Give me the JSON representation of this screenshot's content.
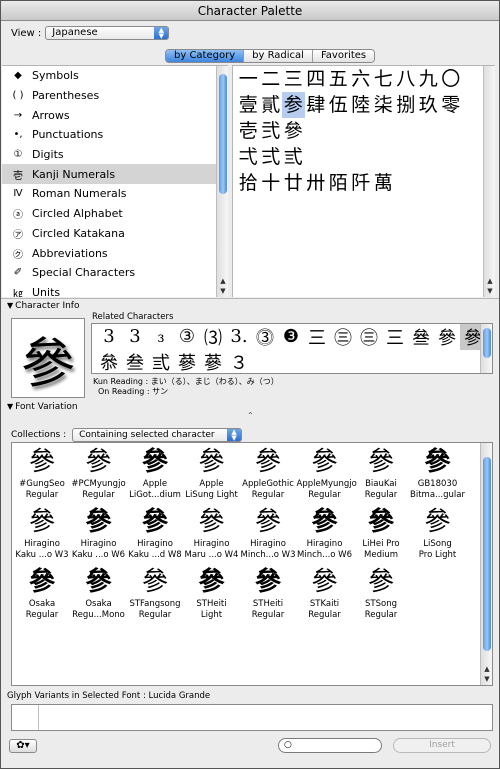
{
  "window": {
    "title": "Character Palette"
  },
  "view": {
    "label": "View :",
    "value": "Japanese"
  },
  "tabs": [
    {
      "label": "by Category",
      "active": true
    },
    {
      "label": "by Radical",
      "active": false
    },
    {
      "label": "Favorites",
      "active": false
    }
  ],
  "categories": [
    {
      "icon": "◆",
      "label": "Symbols"
    },
    {
      "icon": "( )",
      "label": "Parentheses"
    },
    {
      "icon": "→",
      "label": "Arrows"
    },
    {
      "icon": "•,",
      "label": "Punctuations"
    },
    {
      "icon": "①",
      "label": "Digits"
    },
    {
      "icon": "壱",
      "label": "Kanji Numerals",
      "selected": true
    },
    {
      "icon": "Ⅳ",
      "label": "Roman Numerals"
    },
    {
      "icon": "ⓐ",
      "label": "Circled Alphabet"
    },
    {
      "icon": "㋐",
      "label": "Circled Katakana"
    },
    {
      "icon": "㋗",
      "label": "Abbreviations"
    },
    {
      "icon": "✐",
      "label": "Special Characters"
    },
    {
      "icon": "㎏",
      "label": "Units"
    }
  ],
  "kanji_grid": [
    [
      "一",
      "二",
      "三",
      "四",
      "五",
      "六",
      "七",
      "八",
      "九",
      "〇"
    ],
    [
      "壹",
      "貳",
      "参",
      "肆",
      "伍",
      "陸",
      "柒",
      "捌",
      "玖",
      "零"
    ],
    [
      "壱",
      "弐",
      "參"
    ],
    [
      "弌",
      "弍",
      "弎"
    ],
    [
      "拾",
      "十",
      "廿",
      "卅",
      "陌",
      "阡",
      "萬"
    ]
  ],
  "selected_kanji": "参",
  "character_info": {
    "header": "Character Info",
    "glyph": "參",
    "related_label": "Related Characters",
    "related_line1": [
      "3",
      "3",
      "₃",
      "③",
      "⑶",
      "3.",
      "⓷",
      "❸",
      "三",
      "㊂",
      "㊂",
      "三",
      "叄",
      "參",
      "參"
    ],
    "related_line2": [
      "叅",
      "叁",
      "弎",
      "蔘",
      "蔘",
      "３"
    ],
    "kun_label": "Kun Reading :",
    "kun_value": "まい（る）、まじ（わる）、み（つ）",
    "on_label": "On Reading :",
    "on_value": "サン"
  },
  "font_variation": {
    "header": "Font Variation",
    "collections_label": "Collections :",
    "collections_value": "Containing selected character",
    "fonts": [
      {
        "glyph": "參",
        "line1": "#GungSeo",
        "line2": "Regular"
      },
      {
        "glyph": "參",
        "line1": "#PCMyungjo",
        "line2": "Regular"
      },
      {
        "glyph": "參",
        "line1": "Apple",
        "line2": "LiGot...dium"
      },
      {
        "glyph": "參",
        "line1": "Apple",
        "line2": "LiSung Light"
      },
      {
        "glyph": "參",
        "line1": "AppleGothic",
        "line2": "Regular"
      },
      {
        "glyph": "參",
        "line1": "AppleMyungjo",
        "line2": "Regular"
      },
      {
        "glyph": "參",
        "line1": "BiauKai",
        "line2": "Regular"
      },
      {
        "glyph": "參",
        "line1": "GB18030",
        "line2": "Bitma...gular"
      },
      {
        "glyph": "參",
        "line1": "Hiragino",
        "line2": "Kaku ...o W3"
      },
      {
        "glyph": "參",
        "line1": "Hiragino",
        "line2": "Kaku ...o W6"
      },
      {
        "glyph": "參",
        "line1": "Hiragino",
        "line2": "Kaku ...d W8"
      },
      {
        "glyph": "參",
        "line1": "Hiragino",
        "line2": "Maru ...o W4"
      },
      {
        "glyph": "參",
        "line1": "Hiragino",
        "line2": "Minch...o W3"
      },
      {
        "glyph": "參",
        "line1": "Hiragino",
        "line2": "Minch...o W6"
      },
      {
        "glyph": "參",
        "line1": "LiHei Pro",
        "line2": "Medium"
      },
      {
        "glyph": "參",
        "line1": "LiSong",
        "line2": "Pro Light"
      },
      {
        "glyph": "參",
        "line1": "Osaka",
        "line2": "Regular"
      },
      {
        "glyph": "參",
        "line1": "Osaka",
        "line2": "Regu...Mono"
      },
      {
        "glyph": "參",
        "line1": "STFangsong",
        "line2": "Regular"
      },
      {
        "glyph": "參",
        "line1": "STHeiti",
        "line2": "Light"
      },
      {
        "glyph": "參",
        "line1": "STHeiti",
        "line2": "Regular"
      },
      {
        "glyph": "參",
        "line1": "STKaiti",
        "line2": "Regular"
      },
      {
        "glyph": "參",
        "line1": "STSong",
        "line2": "Regular"
      }
    ]
  },
  "glyph_variants": {
    "label": "Glyph Variants in Selected Font : Lucida Grande"
  },
  "bottom": {
    "gear_label": "✿▾",
    "search_placeholder": "",
    "insert_label": "Insert"
  }
}
